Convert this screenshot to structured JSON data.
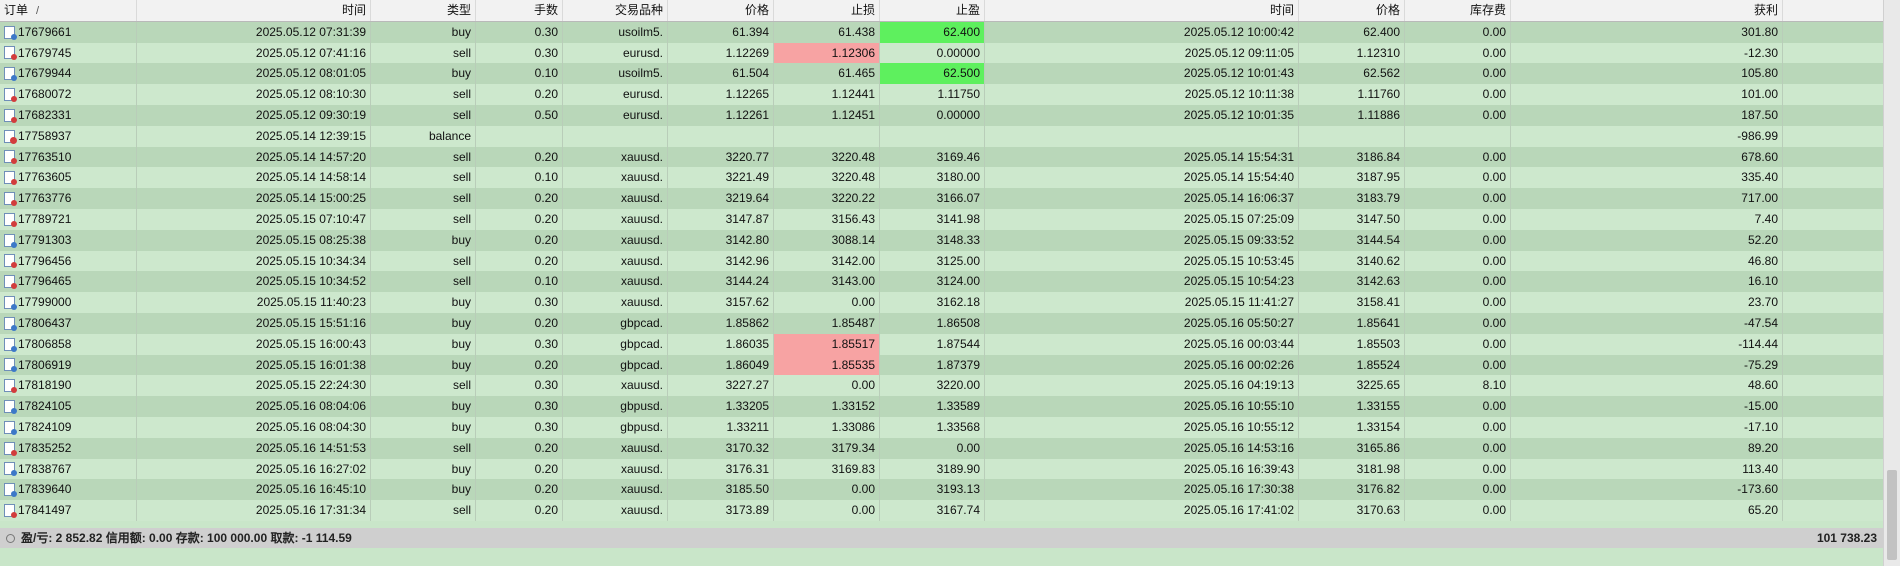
{
  "header": [
    "订单",
    "时间",
    "类型",
    "手数",
    "交易品种",
    "价格",
    "止损",
    "止盈",
    "时间",
    "价格",
    "库存费",
    "获利"
  ],
  "sort_indicator": "/",
  "rows": [
    {
      "order": "17679661",
      "open_time": "2025.05.12 07:31:39",
      "type": "buy",
      "volume": "0.30",
      "symbol": "usoilm5.",
      "price": "61.394",
      "sl": "61.438",
      "tp": "62.400",
      "close_time": "2025.05.12 10:00:42",
      "close_price": "62.400",
      "swap": "0.00",
      "profit": "301.80",
      "hl_tp": "green"
    },
    {
      "order": "17679745",
      "open_time": "2025.05.12 07:41:16",
      "type": "sell",
      "volume": "0.30",
      "symbol": "eurusd.",
      "price": "1.12269",
      "sl": "1.12306",
      "tp": "0.00000",
      "close_time": "2025.05.12 09:11:05",
      "close_price": "1.12310",
      "swap": "0.00",
      "profit": "-12.30",
      "hl_sl": "red"
    },
    {
      "order": "17679944",
      "open_time": "2025.05.12 08:01:05",
      "type": "buy",
      "volume": "0.10",
      "symbol": "usoilm5.",
      "price": "61.504",
      "sl": "61.465",
      "tp": "62.500",
      "close_time": "2025.05.12 10:01:43",
      "close_price": "62.562",
      "swap": "0.00",
      "profit": "105.80",
      "hl_tp": "green"
    },
    {
      "order": "17680072",
      "open_time": "2025.05.12 08:10:30",
      "type": "sell",
      "volume": "0.20",
      "symbol": "eurusd.",
      "price": "1.12265",
      "sl": "1.12441",
      "tp": "1.11750",
      "close_time": "2025.05.12 10:11:38",
      "close_price": "1.11760",
      "swap": "0.00",
      "profit": "101.00"
    },
    {
      "order": "17682331",
      "open_time": "2025.05.12 09:30:19",
      "type": "sell",
      "volume": "0.50",
      "symbol": "eurusd.",
      "price": "1.12261",
      "sl": "1.12451",
      "tp": "0.00000",
      "close_time": "2025.05.12 10:01:35",
      "close_price": "1.11886",
      "swap": "0.00",
      "profit": "187.50"
    },
    {
      "order": "17758937",
      "open_time": "2025.05.14 12:39:15",
      "type": "balance",
      "volume": "",
      "symbol": "",
      "price": "",
      "sl": "",
      "tp": "",
      "close_time": "",
      "close_price": "",
      "swap": "",
      "profit": "-986.99"
    },
    {
      "order": "17763510",
      "open_time": "2025.05.14 14:57:20",
      "type": "sell",
      "volume": "0.20",
      "symbol": "xauusd.",
      "price": "3220.77",
      "sl": "3220.48",
      "tp": "3169.46",
      "close_time": "2025.05.14 15:54:31",
      "close_price": "3186.84",
      "swap": "0.00",
      "profit": "678.60"
    },
    {
      "order": "17763605",
      "open_time": "2025.05.14 14:58:14",
      "type": "sell",
      "volume": "0.10",
      "symbol": "xauusd.",
      "price": "3221.49",
      "sl": "3220.48",
      "tp": "3180.00",
      "close_time": "2025.05.14 15:54:40",
      "close_price": "3187.95",
      "swap": "0.00",
      "profit": "335.40"
    },
    {
      "order": "17763776",
      "open_time": "2025.05.14 15:00:25",
      "type": "sell",
      "volume": "0.20",
      "symbol": "xauusd.",
      "price": "3219.64",
      "sl": "3220.22",
      "tp": "3166.07",
      "close_time": "2025.05.14 16:06:37",
      "close_price": "3183.79",
      "swap": "0.00",
      "profit": "717.00"
    },
    {
      "order": "17789721",
      "open_time": "2025.05.15 07:10:47",
      "type": "sell",
      "volume": "0.20",
      "symbol": "xauusd.",
      "price": "3147.87",
      "sl": "3156.43",
      "tp": "3141.98",
      "close_time": "2025.05.15 07:25:09",
      "close_price": "3147.50",
      "swap": "0.00",
      "profit": "7.40"
    },
    {
      "order": "17791303",
      "open_time": "2025.05.15 08:25:38",
      "type": "buy",
      "volume": "0.20",
      "symbol": "xauusd.",
      "price": "3142.80",
      "sl": "3088.14",
      "tp": "3148.33",
      "close_time": "2025.05.15 09:33:52",
      "close_price": "3144.54",
      "swap": "0.00",
      "profit": "52.20"
    },
    {
      "order": "17796456",
      "open_time": "2025.05.15 10:34:34",
      "type": "sell",
      "volume": "0.20",
      "symbol": "xauusd.",
      "price": "3142.96",
      "sl": "3142.00",
      "tp": "3125.00",
      "close_time": "2025.05.15 10:53:45",
      "close_price": "3140.62",
      "swap": "0.00",
      "profit": "46.80"
    },
    {
      "order": "17796465",
      "open_time": "2025.05.15 10:34:52",
      "type": "sell",
      "volume": "0.10",
      "symbol": "xauusd.",
      "price": "3144.24",
      "sl": "3143.00",
      "tp": "3124.00",
      "close_time": "2025.05.15 10:54:23",
      "close_price": "3142.63",
      "swap": "0.00",
      "profit": "16.10"
    },
    {
      "order": "17799000",
      "open_time": "2025.05.15 11:40:23",
      "type": "buy",
      "volume": "0.30",
      "symbol": "xauusd.",
      "price": "3157.62",
      "sl": "0.00",
      "tp": "3162.18",
      "close_time": "2025.05.15 11:41:27",
      "close_price": "3158.41",
      "swap": "0.00",
      "profit": "23.70"
    },
    {
      "order": "17806437",
      "open_time": "2025.05.15 15:51:16",
      "type": "buy",
      "volume": "0.20",
      "symbol": "gbpcad.",
      "price": "1.85862",
      "sl": "1.85487",
      "tp": "1.86508",
      "close_time": "2025.05.16 05:50:27",
      "close_price": "1.85641",
      "swap": "0.00",
      "profit": "-47.54"
    },
    {
      "order": "17806858",
      "open_time": "2025.05.15 16:00:43",
      "type": "buy",
      "volume": "0.30",
      "symbol": "gbpcad.",
      "price": "1.86035",
      "sl": "1.85517",
      "tp": "1.87544",
      "close_time": "2025.05.16 00:03:44",
      "close_price": "1.85503",
      "swap": "0.00",
      "profit": "-114.44",
      "hl_sl": "red"
    },
    {
      "order": "17806919",
      "open_time": "2025.05.15 16:01:38",
      "type": "buy",
      "volume": "0.20",
      "symbol": "gbpcad.",
      "price": "1.86049",
      "sl": "1.85535",
      "tp": "1.87379",
      "close_time": "2025.05.16 00:02:26",
      "close_price": "1.85524",
      "swap": "0.00",
      "profit": "-75.29",
      "hl_sl": "red"
    },
    {
      "order": "17818190",
      "open_time": "2025.05.15 22:24:30",
      "type": "sell",
      "volume": "0.30",
      "symbol": "xauusd.",
      "price": "3227.27",
      "sl": "0.00",
      "tp": "3220.00",
      "close_time": "2025.05.16 04:19:13",
      "close_price": "3225.65",
      "swap": "8.10",
      "profit": "48.60"
    },
    {
      "order": "17824105",
      "open_time": "2025.05.16 08:04:06",
      "type": "buy",
      "volume": "0.30",
      "symbol": "gbpusd.",
      "price": "1.33205",
      "sl": "1.33152",
      "tp": "1.33589",
      "close_time": "2025.05.16 10:55:10",
      "close_price": "1.33155",
      "swap": "0.00",
      "profit": "-15.00"
    },
    {
      "order": "17824109",
      "open_time": "2025.05.16 08:04:30",
      "type": "buy",
      "volume": "0.30",
      "symbol": "gbpusd.",
      "price": "1.33211",
      "sl": "1.33086",
      "tp": "1.33568",
      "close_time": "2025.05.16 10:55:12",
      "close_price": "1.33154",
      "swap": "0.00",
      "profit": "-17.10"
    },
    {
      "order": "17835252",
      "open_time": "2025.05.16 14:51:53",
      "type": "sell",
      "volume": "0.20",
      "symbol": "xauusd.",
      "price": "3170.32",
      "sl": "3179.34",
      "tp": "0.00",
      "close_time": "2025.05.16 14:53:16",
      "close_price": "3165.86",
      "swap": "0.00",
      "profit": "89.20"
    },
    {
      "order": "17838767",
      "open_time": "2025.05.16 16:27:02",
      "type": "buy",
      "volume": "0.20",
      "symbol": "xauusd.",
      "price": "3176.31",
      "sl": "3169.83",
      "tp": "3189.90",
      "close_time": "2025.05.16 16:39:43",
      "close_price": "3181.98",
      "swap": "0.00",
      "profit": "113.40"
    },
    {
      "order": "17839640",
      "open_time": "2025.05.16 16:45:10",
      "type": "buy",
      "volume": "0.20",
      "symbol": "xauusd.",
      "price": "3185.50",
      "sl": "0.00",
      "tp": "3193.13",
      "close_time": "2025.05.16 17:30:38",
      "close_price": "3176.82",
      "swap": "0.00",
      "profit": "-173.60"
    },
    {
      "order": "17841497",
      "open_time": "2025.05.16 17:31:34",
      "type": "sell",
      "volume": "0.20",
      "symbol": "xauusd.",
      "price": "3173.89",
      "sl": "0.00",
      "tp": "3167.74",
      "close_time": "2025.05.16 17:41:02",
      "close_price": "3170.63",
      "swap": "0.00",
      "profit": "65.20"
    }
  ],
  "footer": {
    "summary": "盈/亏: 2 852.82  信用额: 0.00  存款: 100 000.00  取款: -1 114.59",
    "total": "101 738.23"
  },
  "colors": {
    "sl_hit": "#f7a3a3",
    "tp_hit": "#5ef05e",
    "row_a": "#b9d7b9",
    "row_b": "#cde8cd"
  }
}
